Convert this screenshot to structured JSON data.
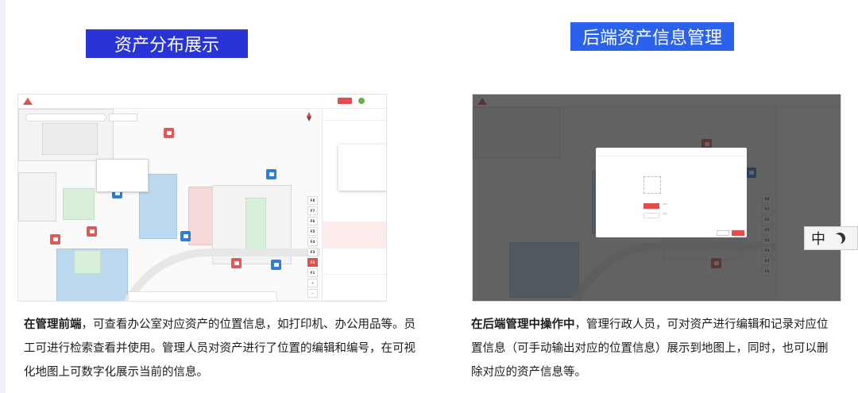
{
  "left_panel": {
    "heading": "资产分布展示",
    "caption_bold": "在管理前端",
    "caption_rest": "，可查看办公室对应资产的位置信息，如打印机、办公用品等。员工可进行检索查看并使用。管理人员对资产进行了位置的编辑和编号，在可视化地图上可数字化展示当前的信息。",
    "floors": [
      "F8",
      "F7",
      "F6",
      "F5",
      "F4",
      "F3",
      "F2",
      "F1"
    ],
    "active_floor": "F2",
    "floor_plus": "+",
    "floor_minus": "−"
  },
  "right_panel": {
    "heading": "后端资产信息管理",
    "caption_bold": "在后端管理中操作中",
    "caption_rest": "，管理行政人员，可对资产进行编辑和记录对应位置信息（可手动输出对应的位置信息）展示到地图上，同时，也可以删除对应的资产信息等。",
    "floors": [
      "F8",
      "F7",
      "F6",
      "F5",
      "F4",
      "F3",
      "F2",
      "F1"
    ]
  },
  "ime": {
    "label": "中"
  },
  "colors": {
    "left_heading_bg": "#2833d8",
    "right_heading_bg": "#2a62ee",
    "accent_red": "#e04f4f",
    "pin_blue": "#2a80d8",
    "room_blue": "#bcd9f0",
    "room_green": "#d9efdb"
  },
  "icons": {
    "pin": "printer-icon",
    "compass": "compass-icon",
    "ime": "moon-icon",
    "upload": "plus-icon"
  }
}
